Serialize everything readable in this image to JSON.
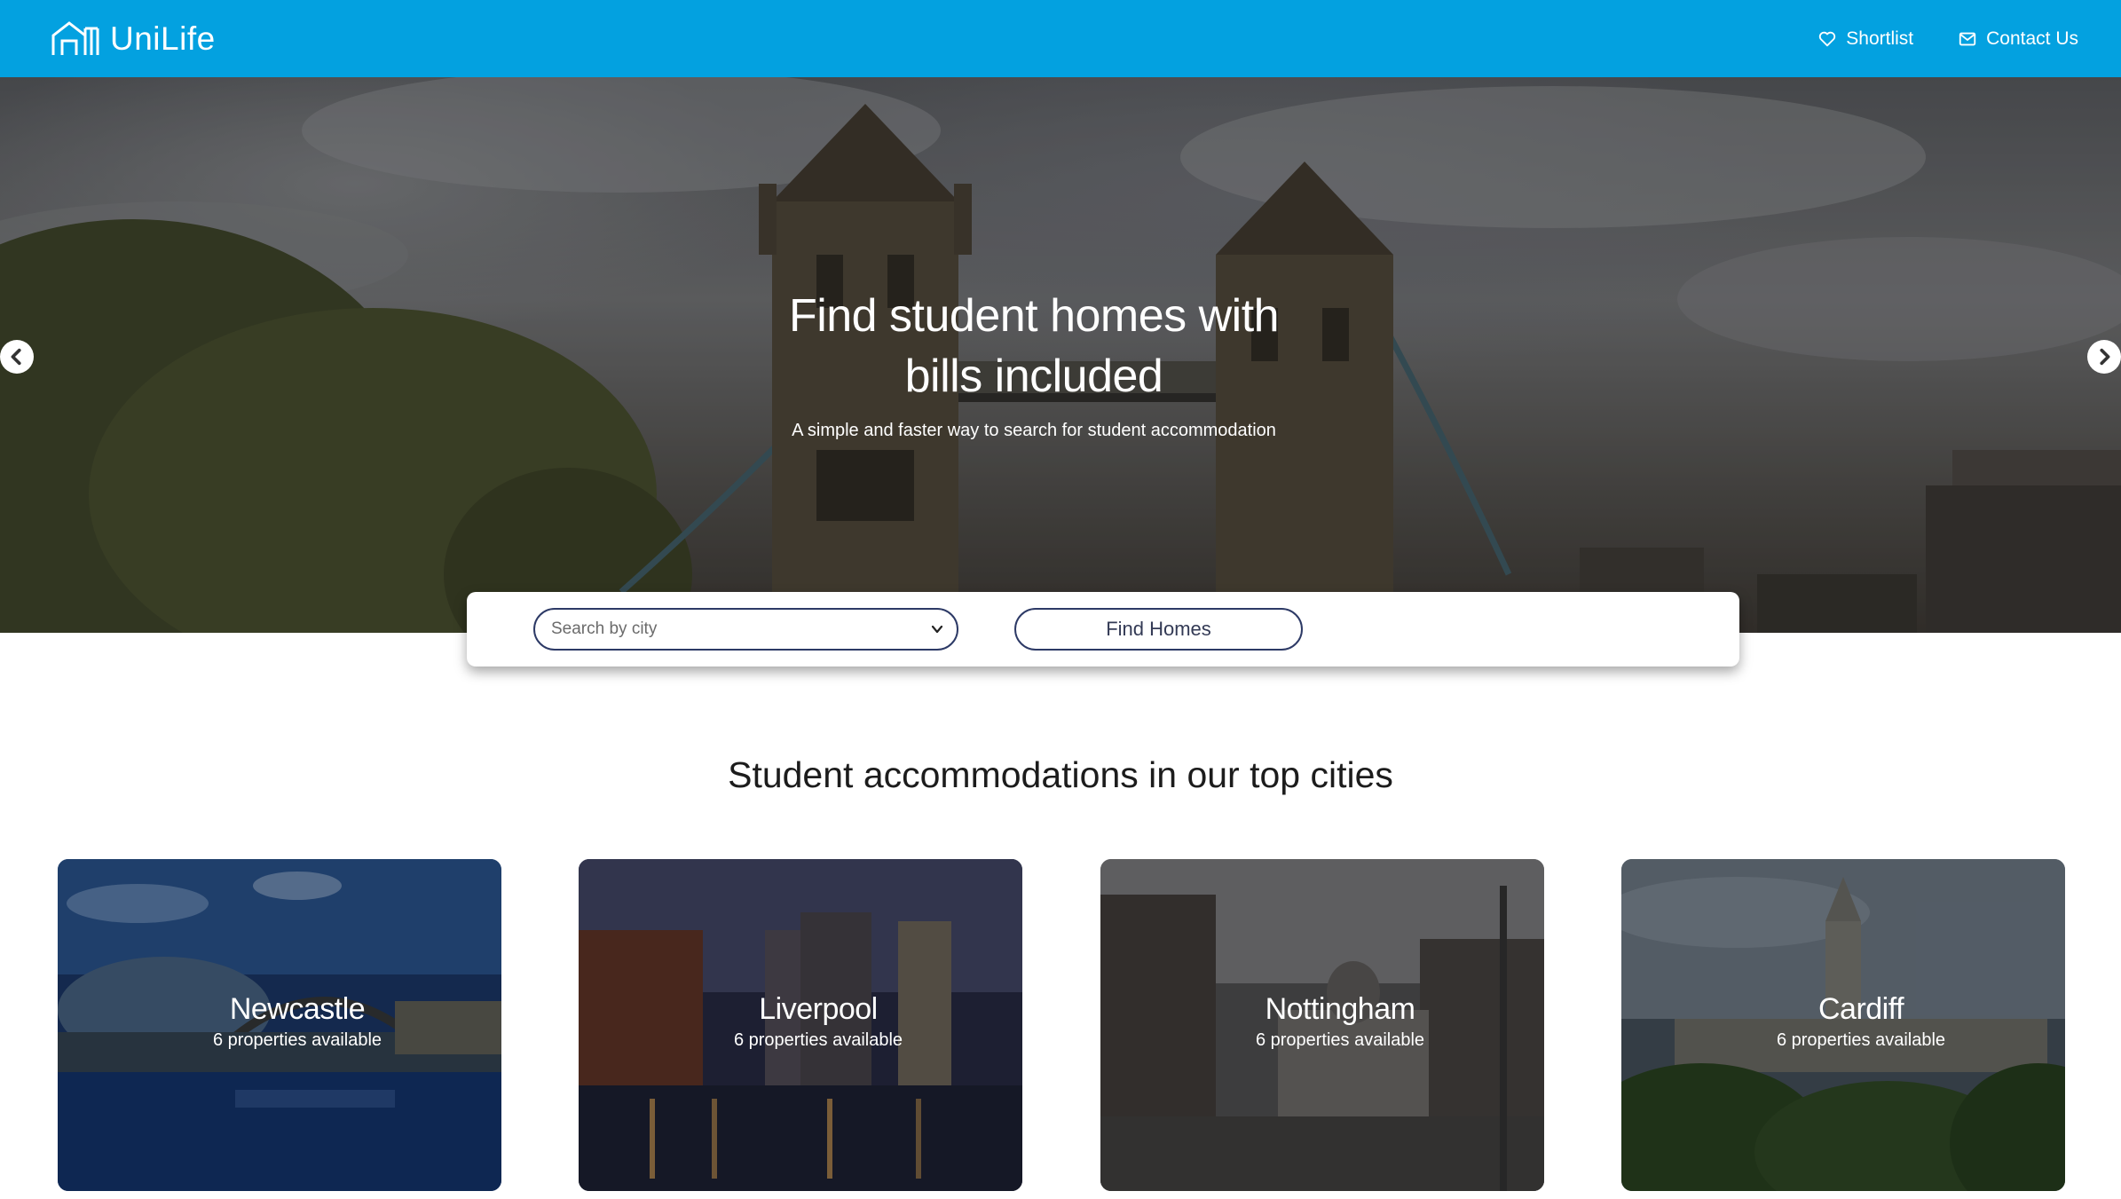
{
  "brand": {
    "name": "UniLife",
    "logo_icon": "house-logo-icon"
  },
  "nav": {
    "shortlist": {
      "label": "Shortlist",
      "icon": "heart-icon"
    },
    "contact": {
      "label": "Contact Us",
      "icon": "mail-icon"
    }
  },
  "hero": {
    "title": "Find student homes with bills included",
    "subtitle": "A simple and faster way to search for student accommodation",
    "prev_icon": "chevron-left-icon",
    "next_icon": "chevron-right-icon"
  },
  "search": {
    "placeholder": "Search by city",
    "button_label": "Find Homes",
    "dropdown_icon": "chevron-down-icon"
  },
  "section": {
    "title": "Student accommodations in our top cities"
  },
  "cities": [
    {
      "name": "Newcastle",
      "count_label": "6 properties available"
    },
    {
      "name": "Liverpool",
      "count_label": "6 properties available"
    },
    {
      "name": "Nottingham",
      "count_label": "6 properties available"
    },
    {
      "name": "Cardiff",
      "count_label": "6 properties available"
    }
  ],
  "colors": {
    "navbar": "#03a1e0",
    "accent_border": "#2d3a66",
    "text_dark": "#1c1c1c"
  }
}
